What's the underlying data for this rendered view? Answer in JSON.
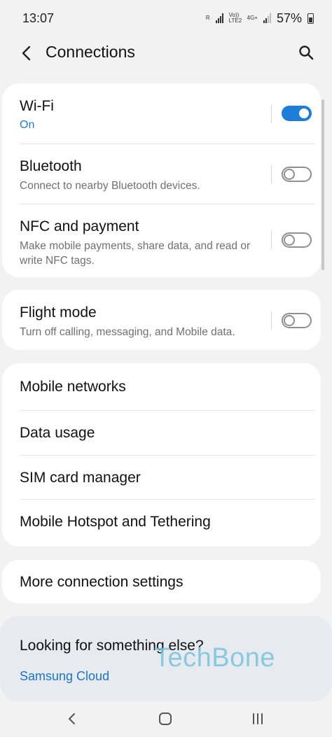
{
  "status_bar": {
    "time": "13:07",
    "network_r": "R",
    "volte_label": "Vo)) LTE2",
    "net_type": "4G+",
    "battery": "57%"
  },
  "header": {
    "title": "Connections"
  },
  "group1": {
    "wifi": {
      "label": "Wi-Fi",
      "status": "On",
      "enabled": true
    },
    "bluetooth": {
      "label": "Bluetooth",
      "description": "Connect to nearby Bluetooth devices.",
      "enabled": false
    },
    "nfc": {
      "label": "NFC and payment",
      "description": "Make mobile payments, share data, and read or write NFC tags.",
      "enabled": false
    }
  },
  "group2": {
    "flight": {
      "label": "Flight mode",
      "description": "Turn off calling, messaging, and Mobile data.",
      "enabled": false
    }
  },
  "group3": {
    "items": [
      "Mobile networks",
      "Data usage",
      "SIM card manager",
      "Mobile Hotspot and Tethering"
    ]
  },
  "group4": {
    "more": "More connection settings"
  },
  "suggestion": {
    "title": "Looking for something else?",
    "link": "Samsung Cloud"
  },
  "watermark": "TechBone",
  "colors": {
    "accent": "#1e7dd8",
    "background": "#f2f2f2",
    "card": "#ffffff"
  }
}
